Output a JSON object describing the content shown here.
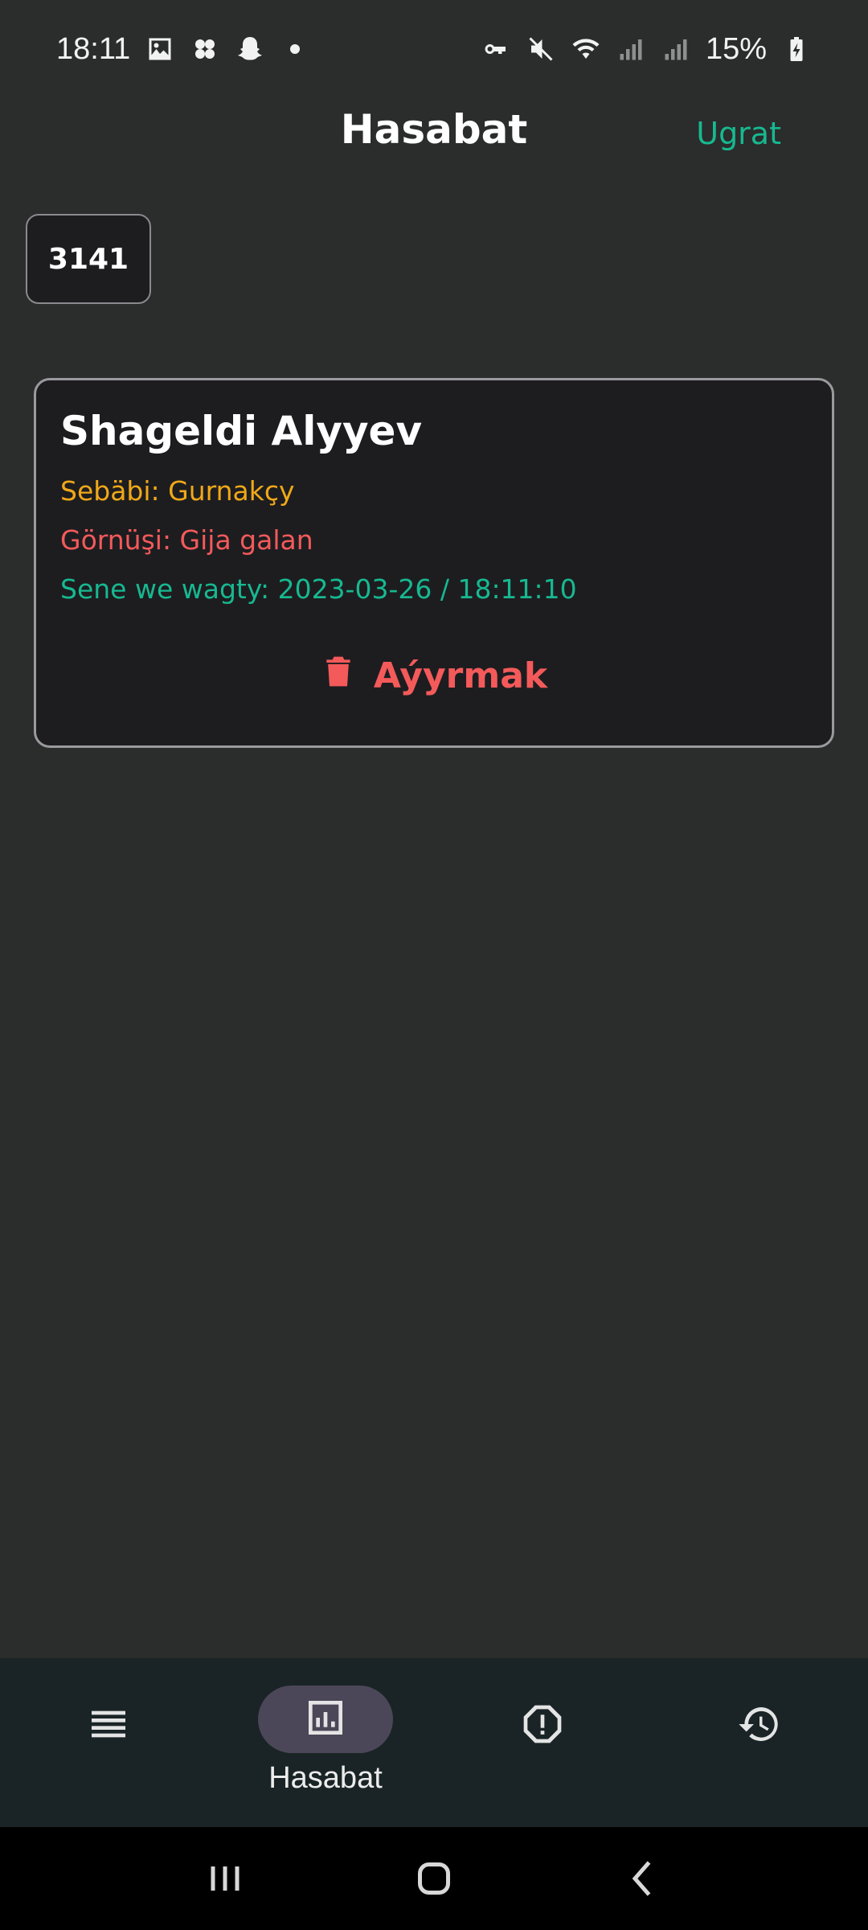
{
  "status_bar": {
    "time": "18:11",
    "battery_percent": "15%",
    "left_icons": [
      "image-icon",
      "pinwheel-icon",
      "snapchat-icon",
      "dot-icon"
    ],
    "right_icons": [
      "vpn-key-icon",
      "mute-icon",
      "wifi-icon",
      "signal-icon",
      "signal-icon",
      "battery-charging-icon"
    ]
  },
  "header": {
    "title": "Hasabat",
    "action_label": "Ugrat"
  },
  "number_chip": {
    "value": "3141"
  },
  "record": {
    "name": "Shageldi Alyyev",
    "reason_line": "Sebäbi: Gurnakçy",
    "type_line": "Görnüşi: Gija galan",
    "datetime_line": "Sene we wagty: 2023-03-26 / 18:11:10",
    "remove_label": "Aýyrmak",
    "remove_icon": "trash-icon"
  },
  "bottom_nav": {
    "items": [
      {
        "icon": "list-icon",
        "label": ""
      },
      {
        "icon": "report-chart-icon",
        "label": "Hasabat",
        "active": true
      },
      {
        "icon": "alert-icon",
        "label": ""
      },
      {
        "icon": "history-icon",
        "label": ""
      }
    ]
  },
  "colors": {
    "background": "#2b2c2c",
    "card": "#1d1d20",
    "accent_green": "#17b890",
    "orange": "#f0a818",
    "red": "#f45a5a",
    "nav_bg": "#1a2426",
    "nav_active": "#4b4758"
  }
}
